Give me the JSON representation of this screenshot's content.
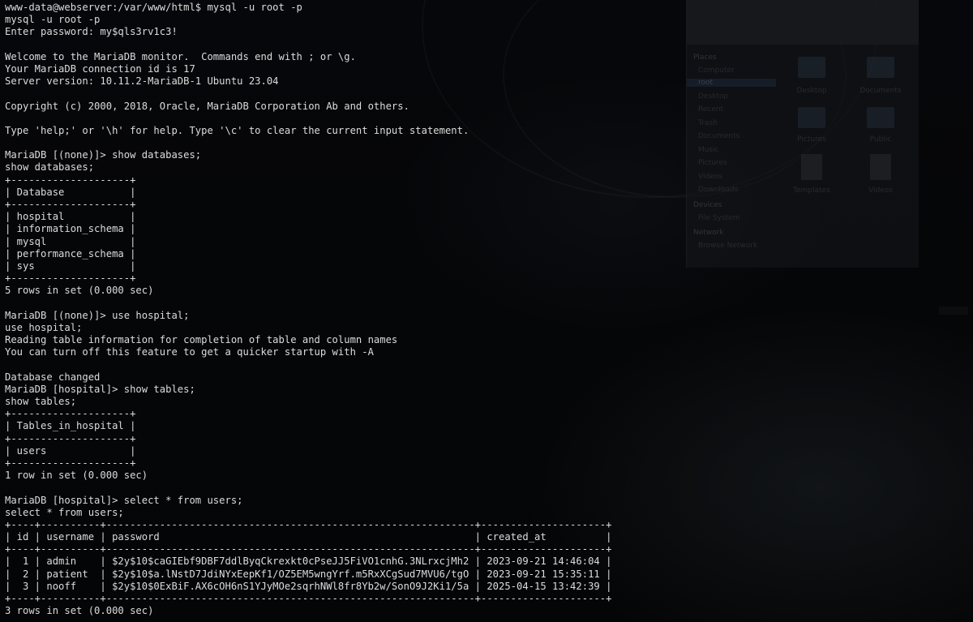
{
  "terminal": {
    "lines": [
      "www-data@webserver:/var/www/html$ mysql -u root -p",
      "mysql -u root -p",
      "Enter password: my$qls3rv1c3!",
      "",
      "Welcome to the MariaDB monitor.  Commands end with ; or \\g.",
      "Your MariaDB connection id is 17",
      "Server version: 10.11.2-MariaDB-1 Ubuntu 23.04",
      "",
      "Copyright (c) 2000, 2018, Oracle, MariaDB Corporation Ab and others.",
      "",
      "Type 'help;' or '\\h' for help. Type '\\c' to clear the current input statement.",
      "",
      "MariaDB [(none)]> show databases;",
      "show databases;",
      "+--------------------+",
      "| Database           |",
      "+--------------------+",
      "| hospital           |",
      "| information_schema |",
      "| mysql              |",
      "| performance_schema |",
      "| sys                |",
      "+--------------------+",
      "5 rows in set (0.000 sec)",
      "",
      "MariaDB [(none)]> use hospital;",
      "use hospital;",
      "Reading table information for completion of table and column names",
      "You can turn off this feature to get a quicker startup with -A",
      "",
      "Database changed",
      "MariaDB [hospital]> show tables;",
      "show tables;",
      "+--------------------+",
      "| Tables_in_hospital |",
      "+--------------------+",
      "| users              |",
      "+--------------------+",
      "1 row in set (0.000 sec)",
      "",
      "MariaDB [hospital]> select * from users;",
      "select * from users;",
      "+----+----------+--------------------------------------------------------------+---------------------+",
      "| id | username | password                                                     | created_at          |",
      "+----+----------+--------------------------------------------------------------+---------------------+",
      "|  1 | admin    | $2y$10$caGIEbf9DBF7ddlByqCkrexkt0cPseJJ5FiVO1cnhG.3NLrxcjMh2 | 2023-09-21 14:46:04 |",
      "|  2 | patient  | $2y$10$a.lNstD7JdiNYxEepKf1/OZ5EM5wngYrf.m5RxXCgSud7MVU6/tgO | 2023-09-21 15:35:11 |",
      "|  3 | nooff    | $2y$10$0ExBiF.AX6cOH6nS1YJyMOe2sqrhNWl8fr8Yb2w/SonO9J2Ki1/5a | 2025-04-15 13:42:39 |",
      "+----+----------+--------------------------------------------------------------+---------------------+",
      "3 rows in set (0.000 sec)"
    ]
  },
  "background_window": {
    "sidebar_title_places": "Places",
    "sidebar_items": [
      "Computer",
      "root",
      "Desktop",
      "Recent",
      "Trash",
      "Documents",
      "Music",
      "Pictures",
      "Videos",
      "Downloads"
    ],
    "sidebar_title_devices": "Devices",
    "device_items": [
      "File System"
    ],
    "sidebar_title_network": "Network",
    "network_items": [
      "Browse Network"
    ],
    "folders": [
      "Desktop",
      "Documents",
      "Pictures",
      "Public"
    ],
    "files": [
      "Templates",
      "Videos"
    ]
  },
  "colors": {
    "terminal_bg": "#050608",
    "terminal_fg": "#dcdcdc"
  }
}
